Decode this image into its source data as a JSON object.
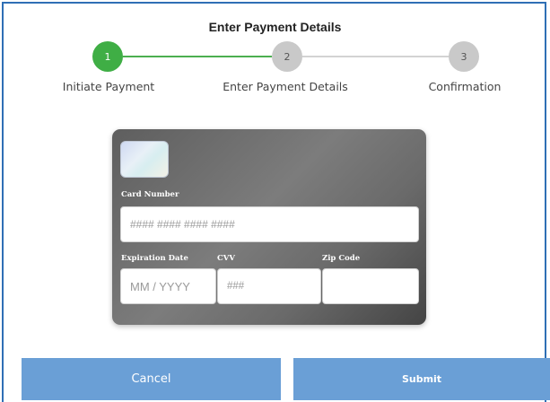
{
  "header": {
    "title": "Enter Payment Details"
  },
  "stepper": {
    "steps": [
      {
        "number": "1",
        "label": "Initiate Payment",
        "state": "complete"
      },
      {
        "number": "2",
        "label": "Enter Payment Details",
        "state": "pending"
      },
      {
        "number": "3",
        "label": "Confirmation",
        "state": "pending"
      }
    ],
    "complete_color": "#3fae45",
    "pending_color": "#c9c9c9"
  },
  "card_form": {
    "card_number": {
      "label": "Card Number",
      "value": "",
      "placeholder": "#### #### #### ####"
    },
    "expiration": {
      "label": "Expiration Date",
      "value": "",
      "placeholder": "MM / YYYY"
    },
    "cvv": {
      "label": "CVV",
      "value": "",
      "placeholder": "###"
    },
    "zip": {
      "label": "Zip Code",
      "value": "",
      "placeholder": ""
    }
  },
  "actions": {
    "cancel_label": "Cancel",
    "submit_label": "Submit",
    "button_color": "#6a9fd6"
  },
  "theme": {
    "border_color": "#2f6fb5"
  }
}
